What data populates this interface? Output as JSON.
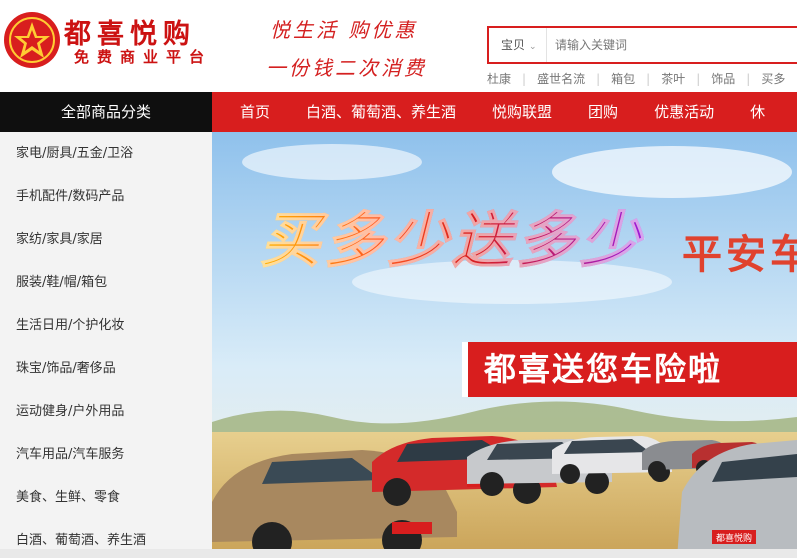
{
  "brand": {
    "name": "都喜悦购",
    "tagline": "免费商业平台",
    "slogan_line1": "悦生活 购优惠",
    "slogan_line2": "一份钱二次消费",
    "color": "#d81e1e"
  },
  "search": {
    "category": "宝贝",
    "placeholder": "请输入关键词",
    "hot_words": [
      "杜康",
      "盛世名流",
      "箱包",
      "茶叶",
      "饰品",
      "买多"
    ]
  },
  "nav": {
    "all_categories": "全部商品分类",
    "links": [
      "首页",
      "白酒、葡萄酒、养生酒",
      "悦购联盟",
      "团购",
      "优惠活动",
      "休"
    ]
  },
  "sidebar": {
    "categories": [
      "家电/厨具/五金/卫浴",
      "手机配件/数码产品",
      "家纺/家具/家居",
      "服装/鞋/帽/箱包",
      "生活日用/个护化妆",
      "珠宝/饰品/奢侈品",
      "运动健身/户外用品",
      "汽车用品/汽车服务",
      "美食、生鲜、零食",
      "白酒、葡萄酒、养生酒"
    ]
  },
  "banner": {
    "headline": "买多少送多少",
    "subheadline": "平安车",
    "tagline": "都喜送您车险啦",
    "plate_text": "都喜悦购"
  }
}
